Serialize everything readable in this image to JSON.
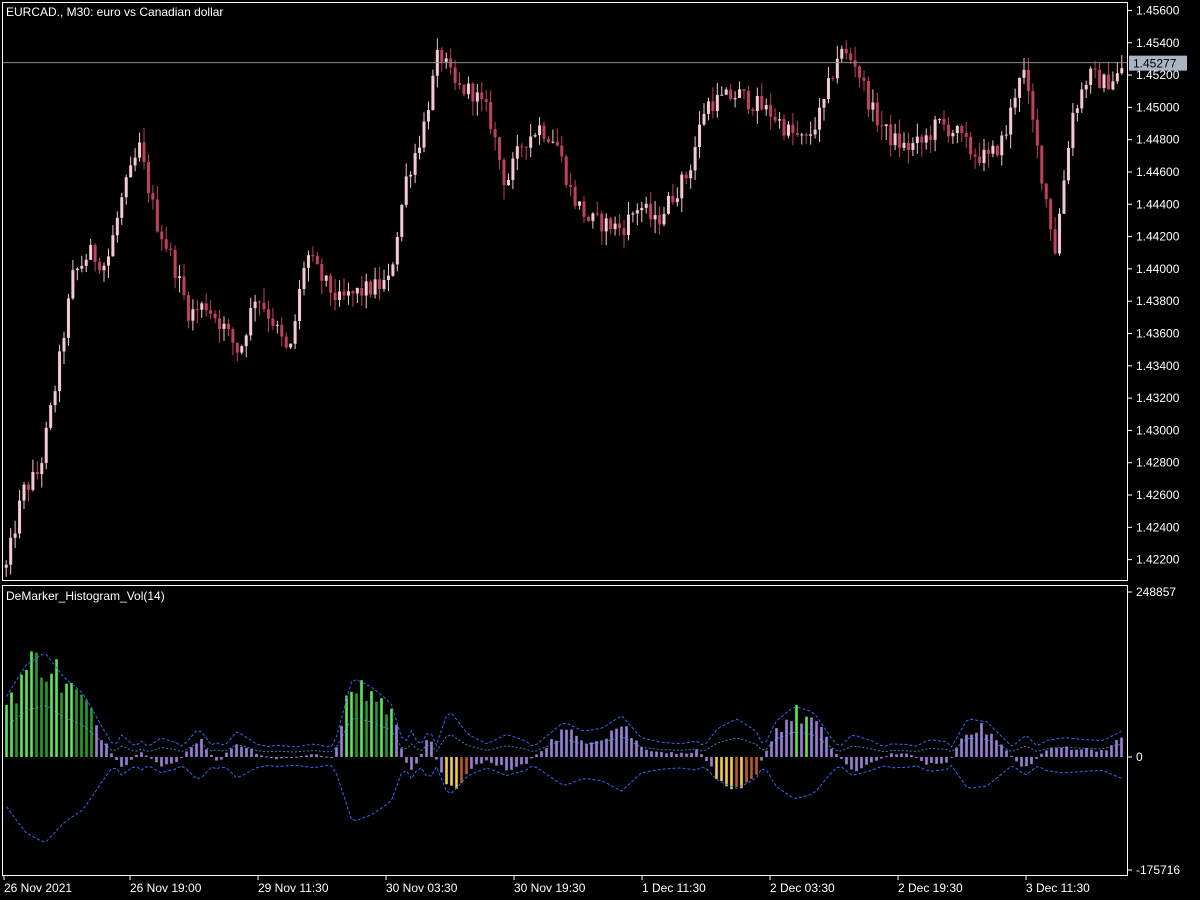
{
  "main_panel": {
    "title": "EURCAD., M30:  euro vs Canadian dollar",
    "current_price": "1.45277",
    "price_range": [
      1.4208,
      1.4564
    ],
    "price_ticks": [
      "1.45600",
      "1.45400",
      "1.45200",
      "1.45000",
      "1.44800",
      "1.44600",
      "1.44400",
      "1.44200",
      "1.44000",
      "1.43800",
      "1.43600",
      "1.43400",
      "1.43200",
      "1.43000",
      "1.42800",
      "1.42600",
      "1.42400",
      "1.42200"
    ],
    "colors": {
      "bull": "#f4c9d4",
      "bear": "#c0405f",
      "price_line": "#8a8a8a",
      "frame": "#ffffff"
    }
  },
  "indicator_panel": {
    "title": "DeMarker_Histogram_Vol(14)",
    "y_top_label": "248857",
    "y_zero_label": "0",
    "y_bottom_label": "-175716",
    "range": [
      -175716,
      248857
    ],
    "colors": {
      "up_strong": "#5fe35a",
      "up_weak": "#2b9a2b",
      "neutral": "#9b7fd6",
      "down_strong": "#f0cc4a",
      "down_weak": "#b85a2a",
      "band": "#2d6bff",
      "band_center": "#4aa0ff"
    }
  },
  "time_axis": {
    "labels": [
      "26 Nov 2021",
      "26 Nov 19:00",
      "29 Nov 11:30",
      "30 Nov 03:30",
      "30 Nov 19:30",
      "1 Dec 11:30",
      "2 Dec 03:30",
      "2 Dec 19:30",
      "3 Dec 11:30"
    ]
  },
  "chart_data": {
    "type": "candlestick",
    "title": "EURCAD., M30:  euro vs Canadian dollar",
    "x_range": [
      "26 Nov 2021",
      "3 Dec 11:30"
    ],
    "price_anchors": [
      1.4215,
      1.4262,
      1.4275,
      1.433,
      1.4395,
      1.441,
      1.4402,
      1.4445,
      1.4475,
      1.443,
      1.4405,
      1.4372,
      1.4378,
      1.4365,
      1.4348,
      1.4385,
      1.4368,
      1.4345,
      1.441,
      1.4393,
      1.438,
      1.4385,
      1.4388,
      1.4392,
      1.4455,
      1.4485,
      1.4535,
      1.4512,
      1.451,
      1.4495,
      1.4452,
      1.4478,
      1.4488,
      1.448,
      1.4445,
      1.443,
      1.4428,
      1.4425,
      1.444,
      1.4428,
      1.4445,
      1.446,
      1.4502,
      1.4505,
      1.4508,
      1.4502,
      1.4496,
      1.4485,
      1.4478,
      1.4498,
      1.4535,
      1.4528,
      1.4498,
      1.4482,
      1.4475,
      1.4478,
      1.449,
      1.4485,
      1.4472,
      1.4468,
      1.4482,
      1.4528,
      1.447,
      1.4412,
      1.4495,
      1.452,
      1.4515,
      1.4522
    ],
    "indicator_anchors": [
      80000,
      130000,
      150000,
      110000,
      85000,
      30000,
      -20000,
      10000,
      -15000,
      -5000,
      30000,
      -10000,
      25000,
      5000,
      -3000,
      0,
      5000,
      -2000,
      110000,
      95000,
      70000,
      -30000,
      30000,
      -60000,
      -20000,
      -5000,
      -20000,
      -10000,
      15000,
      40000,
      25000,
      30000,
      50000,
      15000,
      8000,
      5000,
      10000,
      -30000,
      -45000,
      -25000,
      40000,
      65000,
      55000,
      10000,
      -20000,
      -10000,
      5000,
      4000,
      -12000,
      -8000,
      45000,
      40000,
      10000,
      -20000,
      10000,
      15000,
      12000,
      10000,
      25000
    ]
  }
}
